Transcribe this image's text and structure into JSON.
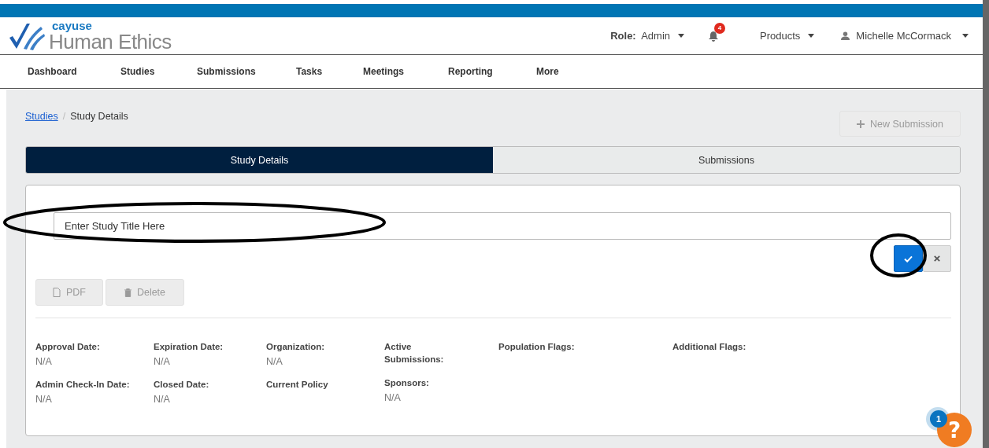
{
  "header": {
    "brand_top": "cayuse",
    "brand_name": "Human Ethics",
    "role_label": "Role:",
    "role_value": "Admin",
    "notification_count": "4",
    "products": "Products",
    "user": "Michelle McCormack"
  },
  "nav": [
    "Dashboard",
    "Studies",
    "Submissions",
    "Tasks",
    "Meetings",
    "Reporting",
    "More"
  ],
  "breadcrumb": {
    "link": "Studies",
    "separator": "/",
    "current": "Study Details"
  },
  "new_submission": {
    "label": "New Submission",
    "disabled": true
  },
  "tabs": [
    {
      "label": "Study Details",
      "selected": true
    },
    {
      "label": "Submissions",
      "selected": false
    }
  ],
  "title_field": {
    "value": "Enter Study Title Here"
  },
  "actions": [
    {
      "label": "PDF",
      "kind": "pdf",
      "disabled": true
    },
    {
      "label": "Delete",
      "kind": "delete",
      "disabled": true
    }
  ],
  "info_columns": [
    [
      {
        "label": "Approval Date:",
        "value": "N/A"
      },
      {
        "label": "Admin Check-In Date:",
        "value": "N/A"
      }
    ],
    [
      {
        "label": "Expiration Date:",
        "value": "N/A"
      },
      {
        "label": "Closed Date:",
        "value": "N/A"
      }
    ],
    [
      {
        "label": "Organization:",
        "value": "N/A"
      },
      {
        "label": "Current Policy"
      }
    ],
    [
      {
        "label": "Active Submissions:"
      },
      {
        "label": "Sponsors:",
        "value": "N/A"
      }
    ],
    [
      {
        "label": "Population Flags:"
      }
    ],
    [
      {
        "label": "Additional Flags:"
      }
    ]
  ],
  "help": {
    "badge": "1",
    "symbol": "?"
  }
}
